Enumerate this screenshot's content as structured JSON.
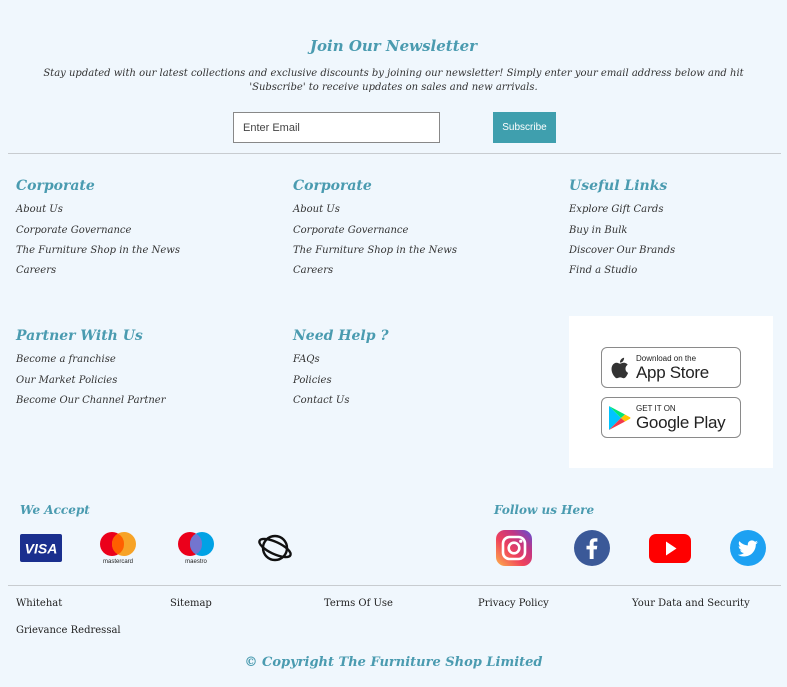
{
  "newsletter": {
    "title": "Join Our Newsletter",
    "description": "Stay updated with our latest collections and exclusive discounts by joining our newsletter! Simply enter your email address below and hit 'Subscribe' to receive updates on sales and new arrivals.",
    "email_placeholder": "Enter Email",
    "subscribe_label": "Subscribe"
  },
  "columns": [
    {
      "title": "Corporate",
      "links": [
        "About Us",
        "Corporate Governance",
        "The Furniture Shop in the News",
        "Careers"
      ]
    },
    {
      "title": "Corporate",
      "links": [
        "About Us",
        "Corporate Governance",
        "The Furniture Shop in the News",
        "Careers"
      ]
    },
    {
      "title": "Useful Links",
      "links": [
        "Explore Gift Cards",
        "Buy in Bulk",
        "Discover Our Brands",
        "Find a Studio"
      ]
    },
    {
      "title": "Partner With Us",
      "links": [
        "Become a franchise",
        "Our Market Policies",
        "Become Our Channel Partner"
      ]
    },
    {
      "title": "Need Help ?",
      "links": [
        "FAQs",
        "Policies",
        "Contact Us"
      ]
    }
  ],
  "app_store": {
    "small": "Download on the",
    "big": "App Store"
  },
  "google_play": {
    "small": "GET IT ON",
    "big": "Google Play"
  },
  "payments": {
    "title": "We Accept",
    "visa": "VISA",
    "mastercard": "mastercard",
    "maestro": "maestro"
  },
  "social": {
    "title": "Follow us Here",
    "icons": [
      "instagram-icon",
      "facebook-icon",
      "youtube-icon",
      "twitter-icon"
    ]
  },
  "bottom_links": [
    "Whitehat",
    "Sitemap",
    "Terms Of Use",
    "Privacy Policy",
    "Your Data and Security",
    "Grievance Redressal"
  ],
  "copyright": "© Copyright The Furniture Shop Limited",
  "colors": {
    "background": "#f0f7fd",
    "accent": "#4a9bb0",
    "subscribe": "#3f9fae"
  }
}
